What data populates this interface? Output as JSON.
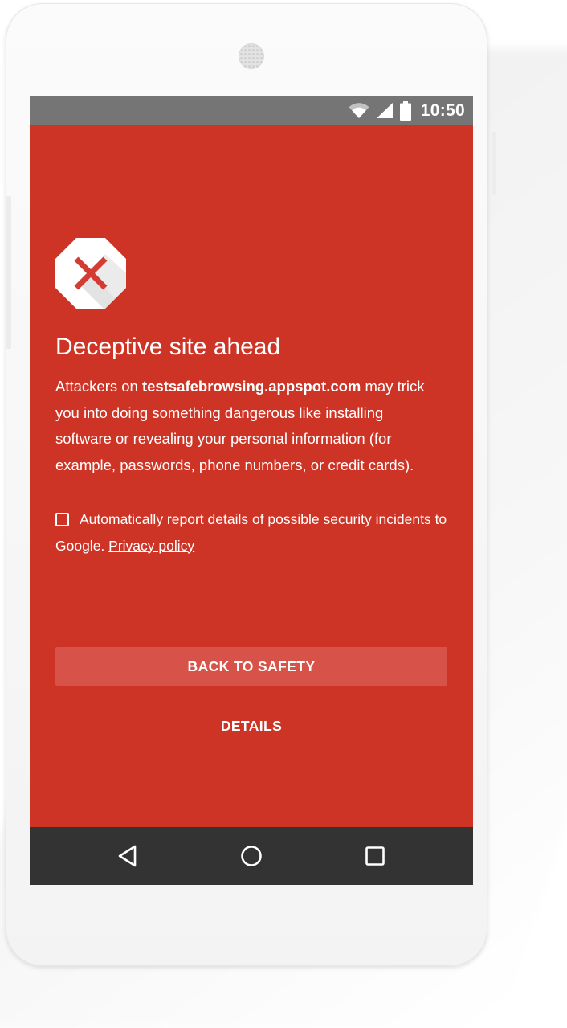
{
  "status_bar": {
    "time": "10:50",
    "icons": [
      "wifi-icon",
      "cell-signal-icon",
      "battery-icon"
    ]
  },
  "warning": {
    "icon": "stop-x-icon",
    "title": "Deceptive site ahead",
    "body_prefix": "Attackers on ",
    "domain": "testsafebrowsing.appspot.com",
    "body_suffix": " may trick you into doing something dangerous like installing software or revealing your personal information (for example, passwords, phone numbers, or credit cards).",
    "report_text": "Automatically report details of possible security incidents to Google.",
    "report_checked": false,
    "privacy_link": "Privacy policy"
  },
  "actions": {
    "back_to_safety": "BACK TO SAFETY",
    "details": "DETAILS"
  },
  "nav_bar": {
    "icons": [
      "back-icon",
      "home-icon",
      "recents-icon"
    ]
  },
  "colors": {
    "page_background": "#ce3426",
    "status_bar": "#757575",
    "nav_bar": "#333333",
    "primary_button": "#d75248",
    "icon_x": "#d33c33"
  }
}
